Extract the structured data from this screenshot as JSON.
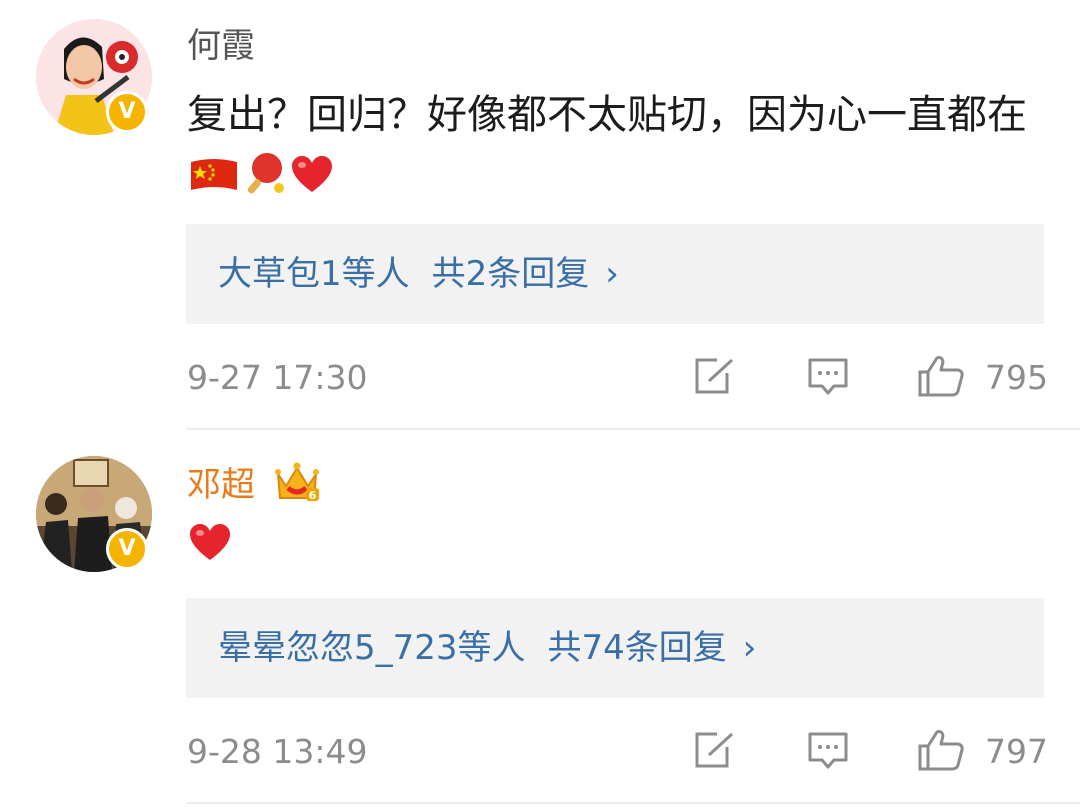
{
  "comments": [
    {
      "username": "何霞",
      "username_color": "#555555",
      "verified_badge": "V",
      "text": "复出？回归？好像都不太贴切，因为心一直都在",
      "emojis": [
        "china-flag-icon",
        "ping-pong-icon",
        "red-heart-icon"
      ],
      "reply_names": "大草包1等人",
      "reply_count": "共2条回复",
      "reply_arrow": "›",
      "time": "9-27 17:30",
      "likes": "795"
    },
    {
      "username": "邓超",
      "username_color": "#eb7a19",
      "verified_badge": "V",
      "member_badge": "crown-member-icon",
      "emojis": [
        "red-heart-icon"
      ],
      "reply_names": "晕晕忽忽5_723等人",
      "reply_count": "共74条回复",
      "reply_arrow": "›",
      "time": "9-28 13:49",
      "likes": "797"
    }
  ],
  "colors": {
    "link": "#3a6fa6",
    "meta": "#8c8c8c",
    "reply_bg": "#f2f2f2",
    "vip_orange": "#eb7a19",
    "badge_yellow": "#f5b400"
  }
}
